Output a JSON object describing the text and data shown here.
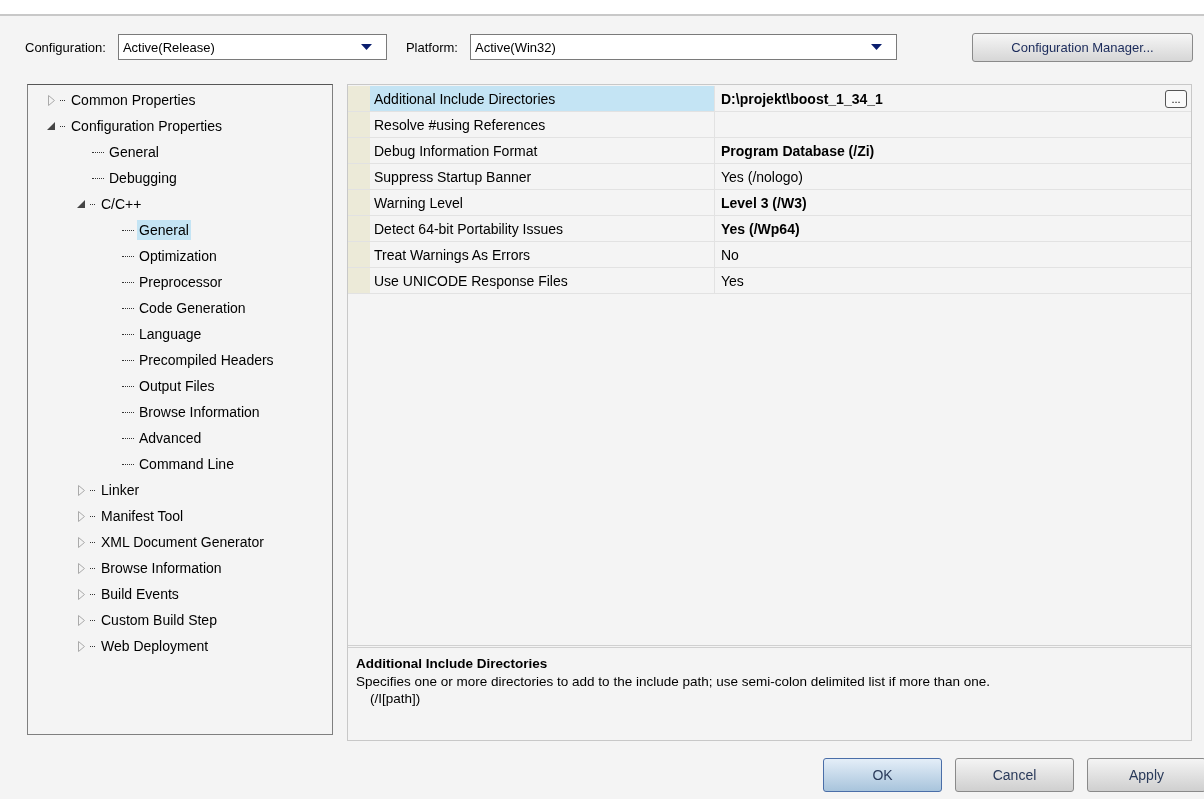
{
  "toolbar": {
    "configuration_label": "Configuration:",
    "configuration_value": "Active(Release)",
    "platform_label": "Platform:",
    "platform_value": "Active(Win32)",
    "manager_button": "Configuration Manager..."
  },
  "tree": [
    {
      "label": "Common Properties",
      "expanded": false,
      "selected": false
    },
    {
      "label": "Configuration Properties",
      "expanded": true,
      "selected": false,
      "children": [
        {
          "label": "General",
          "selected": false
        },
        {
          "label": "Debugging",
          "selected": false
        },
        {
          "label": "C/C++",
          "expanded": true,
          "selected": false,
          "children": [
            {
              "label": "General",
              "selected": true
            },
            {
              "label": "Optimization",
              "selected": false
            },
            {
              "label": "Preprocessor",
              "selected": false
            },
            {
              "label": "Code Generation",
              "selected": false
            },
            {
              "label": "Language",
              "selected": false
            },
            {
              "label": "Precompiled Headers",
              "selected": false
            },
            {
              "label": "Output Files",
              "selected": false
            },
            {
              "label": "Browse Information",
              "selected": false
            },
            {
              "label": "Advanced",
              "selected": false
            },
            {
              "label": "Command Line",
              "selected": false
            }
          ]
        },
        {
          "label": "Linker",
          "expanded": false,
          "selected": false
        },
        {
          "label": "Manifest Tool",
          "expanded": false,
          "selected": false
        },
        {
          "label": "XML Document Generator",
          "expanded": false,
          "selected": false
        },
        {
          "label": "Browse Information",
          "expanded": false,
          "selected": false
        },
        {
          "label": "Build Events",
          "expanded": false,
          "selected": false
        },
        {
          "label": "Custom Build Step",
          "expanded": false,
          "selected": false
        },
        {
          "label": "Web Deployment",
          "expanded": false,
          "selected": false
        }
      ]
    }
  ],
  "properties": [
    {
      "name": "Additional Include Directories",
      "value": "D:\\projekt\\boost_1_34_1",
      "modified": true,
      "selected": true,
      "button": "..."
    },
    {
      "name": "Resolve #using References",
      "selected": false
    },
    {
      "name": "Debug Information Format",
      "value": "Program Database (/Zi)",
      "modified": true,
      "selected": false
    },
    {
      "name": "Suppress Startup Banner",
      "value": "Yes (/nologo)",
      "modified": false,
      "selected": false
    },
    {
      "name": "Warning Level",
      "value": "Level 3 (/W3)",
      "modified": true,
      "selected": false
    },
    {
      "name": "Detect 64-bit Portability Issues",
      "value": "Yes (/Wp64)",
      "modified": true,
      "selected": false
    },
    {
      "name": "Treat Warnings As Errors",
      "value": "No",
      "modified": false,
      "selected": false
    },
    {
      "name": "Use UNICODE Response Files",
      "value": "Yes",
      "modified": false,
      "selected": false
    }
  ],
  "description": {
    "title": "Additional Include Directories",
    "text": "Specifies one or more directories to add to the include path; use semi-colon delimited list if more than one.",
    "switch": "(/I[path])"
  },
  "buttons": [
    {
      "label": "OK",
      "default": true
    },
    {
      "label": "Cancel",
      "default": false
    },
    {
      "label": "Apply",
      "default": false
    }
  ]
}
